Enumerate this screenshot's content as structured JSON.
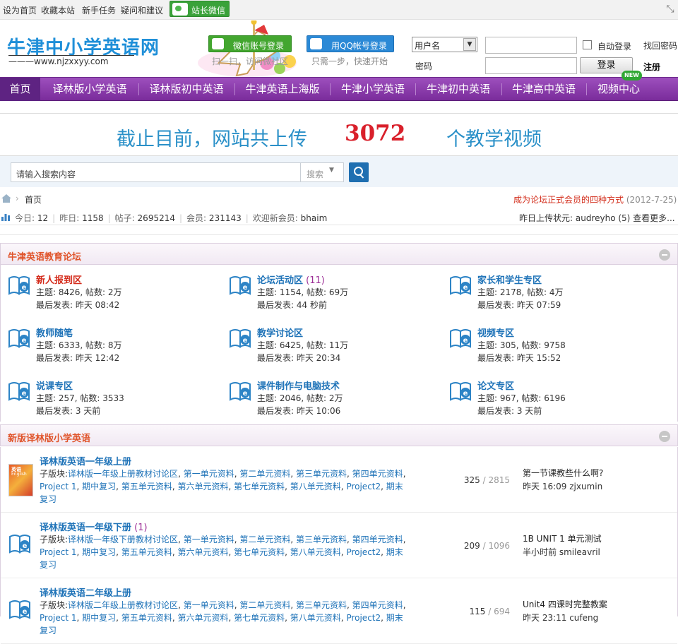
{
  "topbar": {
    "links": [
      "设为首页",
      "收藏本站",
      "新手任务",
      "疑问和建议"
    ],
    "wechat_label": "站长微信"
  },
  "header": {
    "logo_text": "牛津中小学英语网",
    "logo_url": "www.njzxxyy.com",
    "wechat_login_label": "微信账号登录",
    "wechat_tip": "扫一扫，访问微社区",
    "qq_login_label": "用QQ帐号登录",
    "qq_tip": "只需一步，快速开始",
    "username_select": "用户名",
    "password_label": "密码",
    "auto_login_label": "自动登录",
    "forgot_label": "找回密码",
    "login_label": "登录",
    "register_label": "注册"
  },
  "nav": {
    "items": [
      "首页",
      "译林版小学英语",
      "译林版初中英语",
      "牛津英语上海版",
      "牛津小学英语",
      "牛津初中英语",
      "牛津高中英语",
      "视频中心"
    ],
    "new_badge": "NEW"
  },
  "banner": {
    "prefix": "截止目前，网站共上传",
    "count": "3072",
    "suffix": "个教学视频"
  },
  "search": {
    "placeholder": "请输入搜索内容",
    "type_label": "搜索"
  },
  "breadcrumb": {
    "current": "首页",
    "notice": "成为论坛正式会员的四种方式",
    "notice_date": "(2012-7-25)"
  },
  "stats": {
    "today_label": "今日:",
    "today": "12",
    "yesterday_label": "昨日:",
    "yesterday": "1158",
    "posts_label": "帖子:",
    "posts": "2695214",
    "members_label": "会员:",
    "members": "231143",
    "newest_label": "欢迎新会员:",
    "newest": "bhaim",
    "upload_status": "昨日上传状元: audreyho (5) 查看更多..."
  },
  "section1": {
    "title": "牛津英语教育论坛",
    "forums": [
      {
        "name": "新人报到区",
        "count": "",
        "topics": "主题: 8426, 帖数: 2万",
        "last": "最后发表: 昨天 08:42",
        "highlight": true
      },
      {
        "name": "论坛活动区",
        "count": "(11)",
        "topics": "主题: 1154, 帖数: 69万",
        "last": "最后发表: 44 秒前",
        "highlight": false
      },
      {
        "name": "家长和学生专区",
        "count": "",
        "topics": "主题: 2178, 帖数: 4万",
        "last": "最后发表: 昨天 07:59",
        "highlight": false
      },
      {
        "name": "教师随笔",
        "count": "",
        "topics": "主题: 6333, 帖数: 8万",
        "last": "最后发表: 昨天 12:42",
        "highlight": false
      },
      {
        "name": "教学讨论区",
        "count": "",
        "topics": "主题: 6425, 帖数: 11万",
        "last": "最后发表: 昨天 20:34",
        "highlight": false
      },
      {
        "name": "视频专区",
        "count": "",
        "topics": "主题: 305, 帖数: 9758",
        "last": "最后发表: 昨天 15:52",
        "highlight": false
      },
      {
        "name": "说课专区",
        "count": "",
        "topics": "主题: 257, 帖数: 3533",
        "last": "最后发表: 3 天前",
        "highlight": false
      },
      {
        "name": "课件制作与电脑技术",
        "count": "",
        "topics": "主题: 2046, 帖数: 2万",
        "last": "最后发表: 昨天 10:06",
        "highlight": false
      },
      {
        "name": "论文专区",
        "count": "",
        "topics": "主题: 967, 帖数: 6196",
        "last": "最后发表: 3 天前",
        "highlight": false
      }
    ]
  },
  "section2": {
    "title": "新版译林版小学英语",
    "sub_label": "子版块:",
    "rows": [
      {
        "name": "译林版英语一年级上册",
        "count": "",
        "has_cover": true,
        "cover_title": "英语",
        "cover_sub": "English",
        "subs": [
          "译林版一年级上册教材讨论区",
          "第一单元资料",
          "第二单元资料",
          "第三单元资料",
          "第四单元资料",
          "Project 1",
          "期中复习",
          "第五单元资料",
          "第六单元资料",
          "第七单元资料",
          "第八单元资料",
          "Project2",
          "期末复习"
        ],
        "topics": "325",
        "posts": "2815",
        "last_title": "第一节课教些什么啊?",
        "last_meta": "昨天 16:09  zjxumin"
      },
      {
        "name": "译林版英语一年级下册",
        "count": "(1)",
        "has_cover": false,
        "cover_title": "",
        "cover_sub": "",
        "subs": [
          "译林版一年级下册教材讨论区",
          "第一单元资料",
          "第二单元资料",
          "第三单元资料",
          "第四单元资料",
          "Project 1",
          "期中复习",
          "第五单元资料",
          "第六单元资料",
          "第七单元资料",
          "第八单元资料",
          "Project2",
          "期末复习"
        ],
        "topics": "209",
        "posts": "1096",
        "last_title": "1B UNIT 1 单元测试",
        "last_meta": "半小时前  smileavril"
      },
      {
        "name": "译林版英语二年级上册",
        "count": "",
        "has_cover": false,
        "cover_title": "",
        "cover_sub": "",
        "subs": [
          "译林版二年级上册教材讨论区",
          "第一单元资料",
          "第二单元资料",
          "第三单元资料",
          "第四单元资料",
          "Project 1",
          "期中复习",
          "第五单元资料",
          "第六单元资料",
          "第七单元资料",
          "第八单元资料",
          "Project2",
          "期末复习"
        ],
        "topics": "115",
        "posts": "694",
        "last_title": "Unit4 四课时完整教案",
        "last_meta": "昨天 23:11  cufeng"
      }
    ]
  },
  "colors": {
    "nav_purple": "#8a3aad",
    "link_blue": "#1f73b8",
    "section_title": "#e0542b",
    "banner_blue": "#2a90c8",
    "banner_red": "#d9202b"
  }
}
